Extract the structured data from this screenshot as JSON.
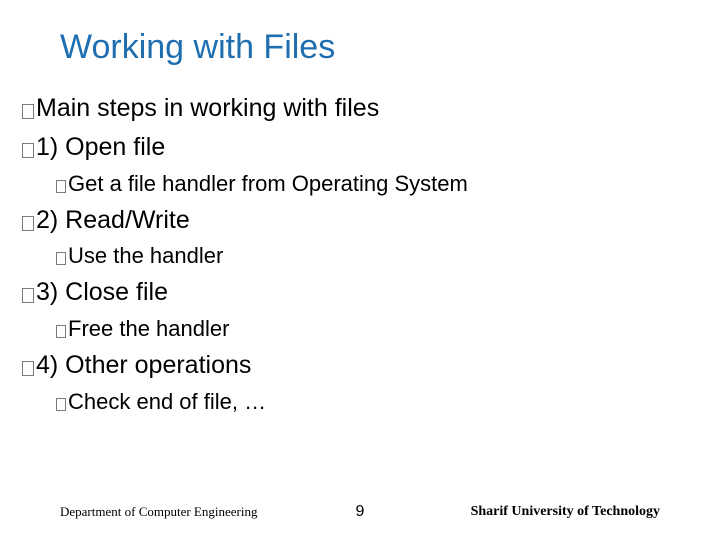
{
  "title": "Working with Files",
  "lines": [
    {
      "level": 1,
      "text": "Main steps in working with files"
    },
    {
      "level": 1,
      "text": "1) Open file"
    },
    {
      "level": 2,
      "text": "Get a file handler from Operating System"
    },
    {
      "level": 1,
      "text": "2) Read/Write"
    },
    {
      "level": 2,
      "text": "Use the handler"
    },
    {
      "level": 1,
      "text": "3) Close file"
    },
    {
      "level": 2,
      "text": "Free the handler"
    },
    {
      "level": 1,
      "text": "4) Other operations"
    },
    {
      "level": 2,
      "text": "Check end of file, …"
    }
  ],
  "footer": {
    "left": "Department of Computer Engineering",
    "page": "9",
    "right": "Sharif University of Technology"
  }
}
